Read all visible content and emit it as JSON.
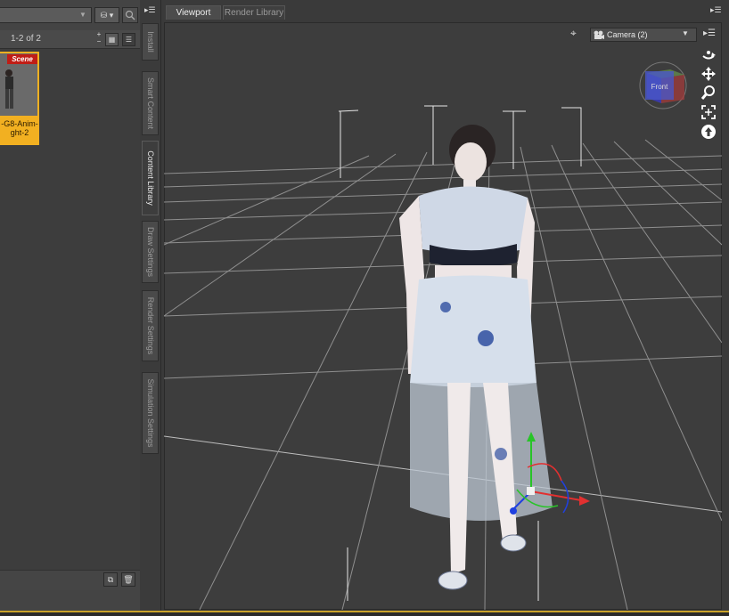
{
  "content_pane": {
    "page_count": "1-2 of 2",
    "item": {
      "badge": "Scene",
      "label": "-G8-Anim-\nght-2"
    }
  },
  "side_tabs": [
    "Install",
    "Smart Content",
    "Content Library",
    "Draw Settings",
    "Render Settings",
    "Simulation Settings"
  ],
  "viewport_tabs": {
    "viewport": "Viewport",
    "render_library": "Render Library"
  },
  "camera_select": {
    "selected": "Camera (2)"
  },
  "view_cube": {
    "face_label": "Front"
  },
  "colors": {
    "accent": "#f2b021",
    "badge": "#c01d16",
    "gizmo_x": "#e23030",
    "gizmo_y": "#28c428",
    "gizmo_z": "#2040e0"
  },
  "icons": [
    "search-icon",
    "database-icon",
    "grid-view-icon",
    "list-view-icon",
    "copy-icon",
    "trash-icon",
    "panel-menu-icon",
    "pin-icon",
    "camera-icon",
    "orbit-icon",
    "pan-icon",
    "zoom-icon",
    "frame-icon",
    "up-arrow-icon"
  ]
}
